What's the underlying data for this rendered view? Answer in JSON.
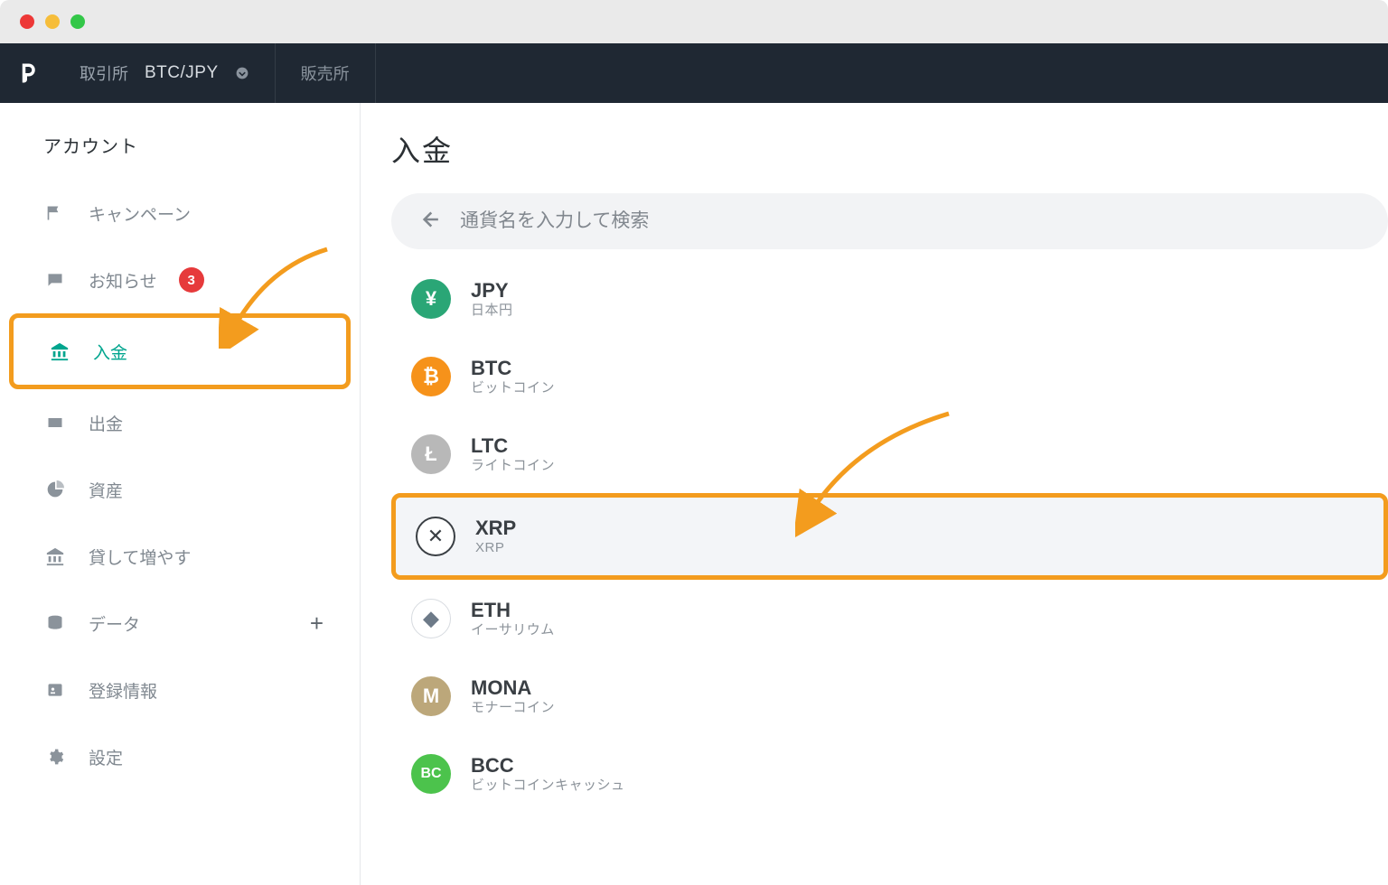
{
  "header": {
    "exchange_label": "取引所",
    "pair": "BTC/JPY",
    "sales_label": "販売所"
  },
  "sidebar": {
    "title": "アカウント",
    "items": {
      "campaign": "キャンペーン",
      "notice": "お知らせ",
      "notice_badge": "3",
      "deposit": "入金",
      "withdraw": "出金",
      "assets": "資産",
      "lend": "貸して増やす",
      "data": "データ",
      "registration": "登録情報",
      "settings": "設定"
    }
  },
  "main": {
    "title": "入金",
    "search_placeholder": "通貨名を入力して検索"
  },
  "currencies": {
    "jpy": {
      "code": "JPY",
      "name": "日本円",
      "glyph": "¥"
    },
    "btc": {
      "code": "BTC",
      "name": "ビットコイン",
      "glyph": "₿"
    },
    "ltc": {
      "code": "LTC",
      "name": "ライトコイン",
      "glyph": "Ł"
    },
    "xrp": {
      "code": "XRP",
      "name": "XRP",
      "glyph": "✕"
    },
    "eth": {
      "code": "ETH",
      "name": "イーサリウム",
      "glyph": "◆"
    },
    "mona": {
      "code": "MONA",
      "name": "モナーコイン",
      "glyph": "M"
    },
    "bcc": {
      "code": "BCC",
      "name": "ビットコインキャッシュ",
      "glyph": "BC"
    }
  }
}
